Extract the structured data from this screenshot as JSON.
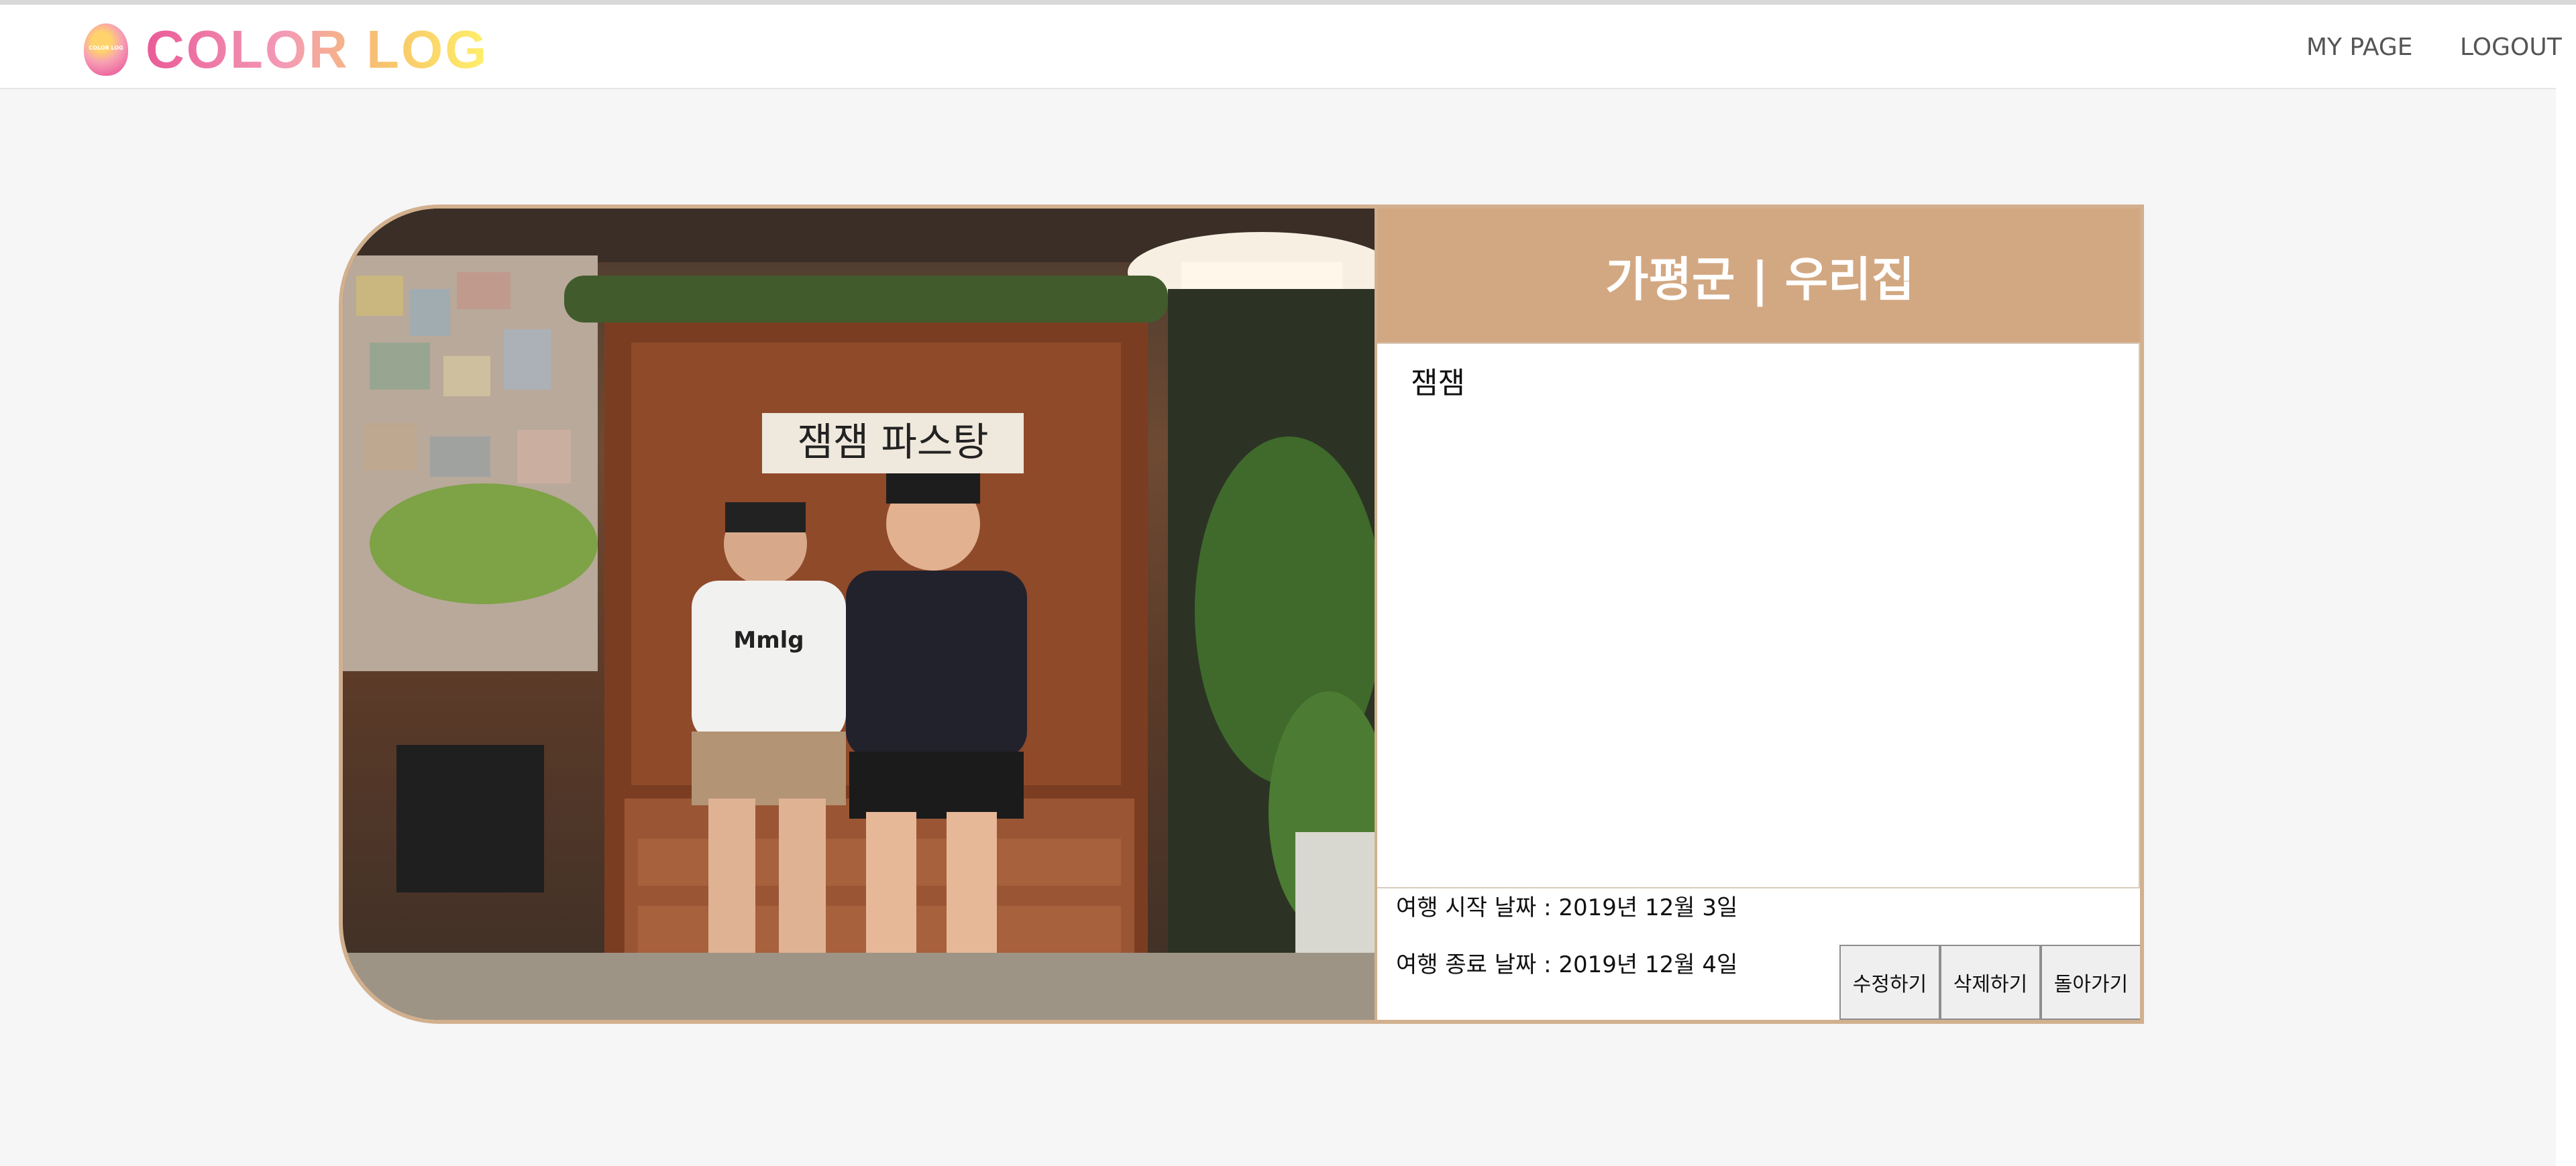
{
  "header": {
    "logo_text": "COLOR LOG",
    "logo_badge": "COLOR LOG",
    "nav": {
      "mypage": "MY PAGE",
      "logout": "LOGOUT"
    }
  },
  "post": {
    "title": "가평군 | 우리집",
    "content": "잼잼",
    "start_date": "여행 시작 날짜 : 2019년 12월 3일",
    "end_date": "여행 종료 날짜 : 2019년 12월 4일",
    "photo_sign_text": "잼잼 파스탕",
    "photo_shirt_text": "Mmlg"
  },
  "buttons": {
    "edit": "수정하기",
    "delete": "삭제하기",
    "back": "돌아가기"
  },
  "colors": {
    "accent": "#d2a882",
    "border": "#d2b08e",
    "background": "#f6f6f6"
  }
}
